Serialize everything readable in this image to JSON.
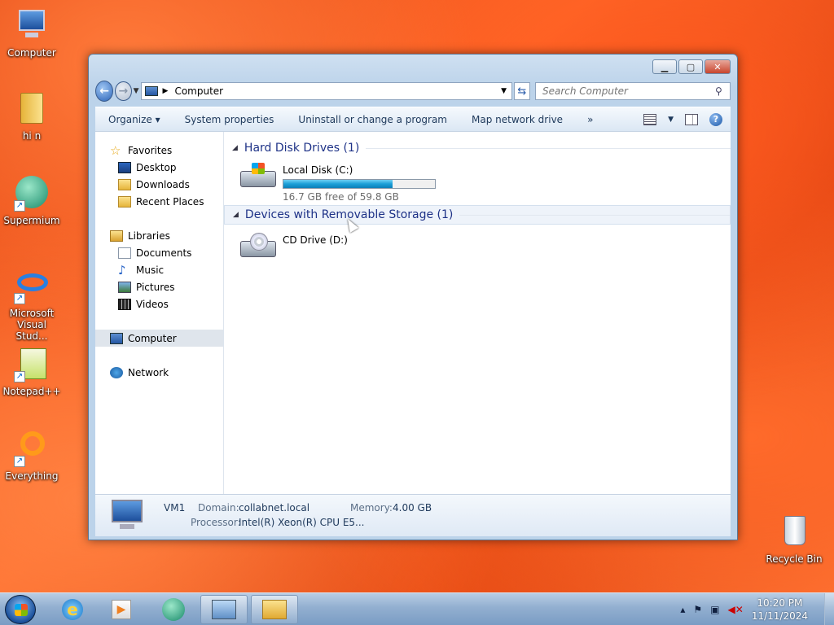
{
  "desktop": {
    "icons": [
      {
        "label": "Computer",
        "icon": "computer-icon"
      },
      {
        "label": "hi n",
        "icon": "folder-icon"
      },
      {
        "label": "Supermium",
        "icon": "supermium-icon"
      },
      {
        "label": "Microsoft Visual Stud...",
        "icon": "visual-studio-icon"
      },
      {
        "label": "Notepad++",
        "icon": "notepadpp-icon"
      },
      {
        "label": "Everything",
        "icon": "everything-icon"
      },
      {
        "label": "Recycle Bin",
        "icon": "recycle-bin-icon"
      }
    ]
  },
  "window": {
    "address": {
      "location": "Computer"
    },
    "search": {
      "placeholder": "Search Computer"
    },
    "toolbar": {
      "organize": "Organize ▾",
      "system_properties": "System properties",
      "uninstall": "Uninstall or change a program",
      "map_drive": "Map network drive",
      "more": "»"
    },
    "nav": {
      "favorites": "Favorites",
      "desktop": "Desktop",
      "downloads": "Downloads",
      "recent": "Recent Places",
      "libraries": "Libraries",
      "documents": "Documents",
      "music": "Music",
      "pictures": "Pictures",
      "videos": "Videos",
      "computer": "Computer",
      "network": "Network"
    },
    "groups": {
      "hdd": "Hard Disk Drives (1)",
      "removable": "Devices with Removable Storage (1)"
    },
    "drives": {
      "c": {
        "name": "Local Disk (C:)",
        "free_text": "16.7 GB free of 59.8 GB",
        "used_fraction": 0.72
      },
      "d": {
        "name": "CD Drive (D:)"
      }
    },
    "details": {
      "name": "VM1",
      "domain_label": "Domain:",
      "domain": "collabnet.local",
      "memory_label": "Memory:",
      "memory": "4.00 GB",
      "processor_label": "Processor:",
      "processor": "Intel(R) Xeon(R) CPU E5..."
    }
  },
  "taskbar": {
    "time": "10:20 PM",
    "date": "11/11/2024"
  }
}
